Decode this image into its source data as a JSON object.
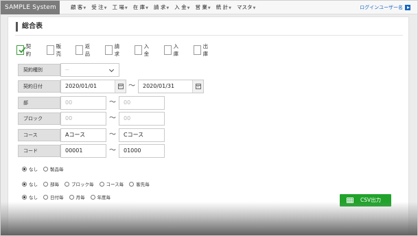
{
  "app": {
    "brand": "SAMPLE System"
  },
  "nav": {
    "items": [
      "顧 客",
      "受 注",
      "工 場",
      "在 庫",
      "請 求",
      "入 金",
      "営 業",
      "統 計",
      "マスタ"
    ],
    "user_link": "ログインユーザー名"
  },
  "page": {
    "title": "総合表"
  },
  "types": [
    {
      "label": "契約",
      "checked": true
    },
    {
      "label": "販売",
      "checked": false
    },
    {
      "label": "返品",
      "checked": false
    },
    {
      "label": "請求",
      "checked": false
    },
    {
      "label": "入金",
      "checked": false
    },
    {
      "label": "入庫",
      "checked": false
    },
    {
      "label": "出庫",
      "checked": false
    }
  ],
  "form": {
    "contract_type": {
      "label": "契約種別",
      "value": "--"
    },
    "contract_date": {
      "label": "契約日付",
      "from": "2020/01/01",
      "to": "2020/01/31"
    },
    "department": {
      "label": "部",
      "from_placeholder": "00",
      "to_placeholder": "00"
    },
    "block": {
      "label": "ブロック",
      "from_placeholder": "00",
      "to_placeholder": "00"
    },
    "course": {
      "label": "コース",
      "from": "Aコース",
      "to": "Cコース"
    },
    "code": {
      "label": "コード",
      "from": "00001",
      "to": "01000"
    },
    "tilde": "〜"
  },
  "groupings": [
    {
      "options": [
        "なし",
        "製品毎"
      ],
      "selected": 0
    },
    {
      "options": [
        "なし",
        "部毎",
        "ブロック毎",
        "コース毎",
        "客先毎"
      ],
      "selected": 0
    },
    {
      "options": [
        "なし",
        "日付毎",
        "月毎",
        "年度毎"
      ],
      "selected": 0
    }
  ],
  "actions": {
    "csv_label": "CSV出力"
  },
  "colors": {
    "brand_bg": "#7c7c7c",
    "link": "#1565c0",
    "csv_button": "#21a32b",
    "check": "#3a9a3a"
  }
}
